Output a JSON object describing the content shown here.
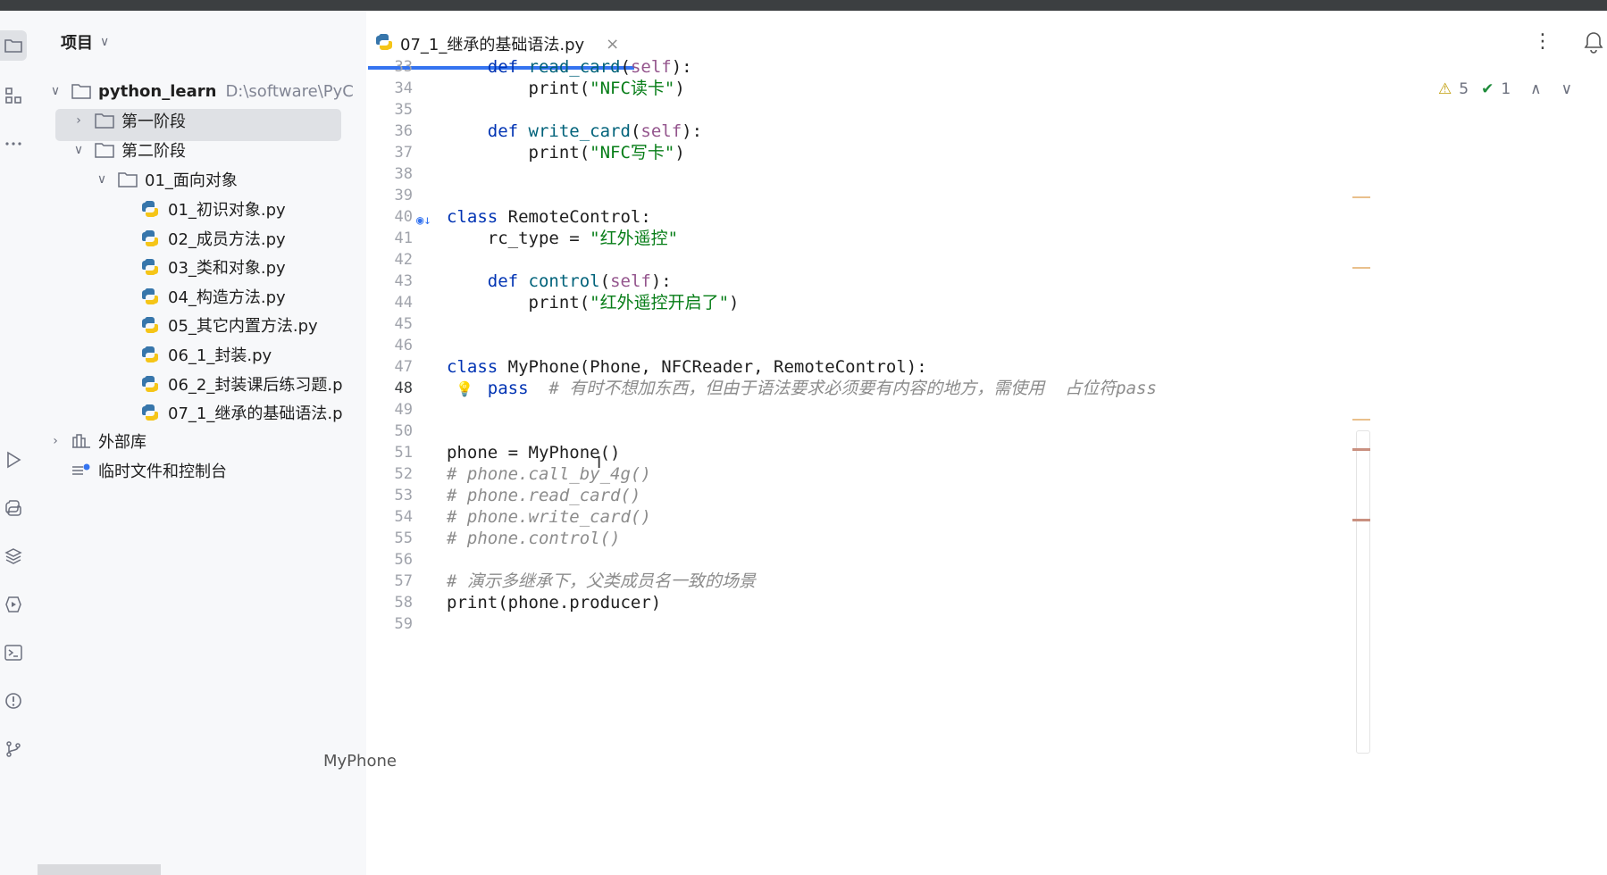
{
  "project_panel": {
    "title": "项目",
    "root": {
      "name": "python_learn",
      "path": "D:\\software\\PyC"
    },
    "items": [
      {
        "label": "第一阶段",
        "type": "folder",
        "expanded": false,
        "depth": 1,
        "selected": true
      },
      {
        "label": "第二阶段",
        "type": "folder",
        "expanded": true,
        "depth": 1
      },
      {
        "label": "01_面向对象",
        "type": "folder",
        "expanded": true,
        "depth": 2
      },
      {
        "label": "01_初识对象.py",
        "type": "python-file",
        "depth": 3
      },
      {
        "label": "02_成员方法.py",
        "type": "python-file",
        "depth": 3
      },
      {
        "label": "03_类和对象.py",
        "type": "python-file",
        "depth": 3
      },
      {
        "label": "04_构造方法.py",
        "type": "python-file",
        "depth": 3
      },
      {
        "label": "05_其它内置方法.py",
        "type": "python-file",
        "depth": 3
      },
      {
        "label": "06_1_封装.py",
        "type": "python-file",
        "depth": 3
      },
      {
        "label": "06_2_封装课后练习题.p",
        "type": "python-file",
        "depth": 3
      },
      {
        "label": "07_1_继承的基础语法.p",
        "type": "python-file",
        "depth": 3
      }
    ],
    "external_libs": "外部库",
    "scratches": "临时文件和控制台"
  },
  "editor": {
    "tab_label": "07_1_继承的基础语法.py",
    "close_glyph": "×",
    "more_glyph": "⋮",
    "inspection": {
      "warnings": "5",
      "ok": "1",
      "up": "∧",
      "down": "∨"
    },
    "breadcrumb": "MyPhone",
    "current_line": "48"
  },
  "code_lines": [
    {
      "n": "33",
      "text": "    def read_card(self):"
    },
    {
      "n": "34",
      "text": "        print(\"NFC读卡\")"
    },
    {
      "n": "35",
      "text": ""
    },
    {
      "n": "36",
      "text": "    def write_card(self):"
    },
    {
      "n": "37",
      "text": "        print(\"NFC写卡\")"
    },
    {
      "n": "38",
      "text": ""
    },
    {
      "n": "39",
      "text": ""
    },
    {
      "n": "40",
      "text": "class RemoteControl:"
    },
    {
      "n": "41",
      "text": "    rc_type = \"红外遥控\""
    },
    {
      "n": "42",
      "text": ""
    },
    {
      "n": "43",
      "text": "    def control(self):"
    },
    {
      "n": "44",
      "text": "        print(\"红外遥控开启了\")"
    },
    {
      "n": "45",
      "text": ""
    },
    {
      "n": "46",
      "text": ""
    },
    {
      "n": "47",
      "text": "class MyPhone(Phone, NFCReader, RemoteControl):"
    },
    {
      "n": "48",
      "text": "    pass  # 有时不想加东西，但由于语法要求必须要有内容的地方，需使用  占位符pass"
    },
    {
      "n": "49",
      "text": ""
    },
    {
      "n": "50",
      "text": ""
    },
    {
      "n": "51",
      "text": "phone = MyPhone()"
    },
    {
      "n": "52",
      "text": "# phone.call_by_4g()"
    },
    {
      "n": "53",
      "text": "# phone.read_card()"
    },
    {
      "n": "54",
      "text": "# phone.write_card()"
    },
    {
      "n": "55",
      "text": "# phone.control()"
    },
    {
      "n": "56",
      "text": ""
    },
    {
      "n": "57",
      "text": "# 演示多继承下，父类成员名一致的场景"
    },
    {
      "n": "58",
      "text": "print(phone.producer)"
    },
    {
      "n": "59",
      "text": ""
    }
  ],
  "colors": {
    "keyword": "#0033b3",
    "function": "#00627a",
    "string": "#067d17",
    "self": "#94558d",
    "comment": "#8c8c8c",
    "selection": "#dfe1e5"
  }
}
